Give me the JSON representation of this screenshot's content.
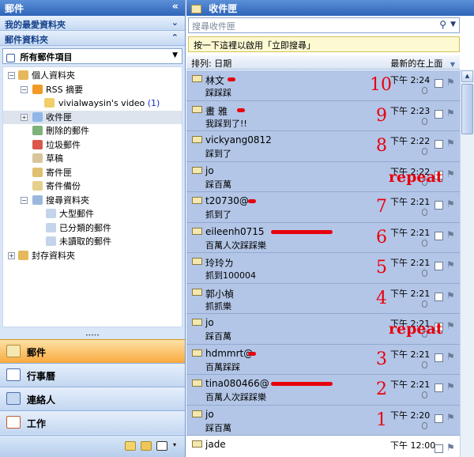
{
  "nav": {
    "title": "郵件",
    "collapse_glyph": "«",
    "favorites_header": "我的最愛資料夾",
    "mail_folders_header": "郵件資料夾",
    "filter_value": "所有郵件項目",
    "tree": [
      {
        "label": "個人資料夾",
        "icon": "personal-folders-icon"
      },
      {
        "label": "RSS 摘要",
        "icon": "rss-icon"
      },
      {
        "label": "vivialwaysin's video",
        "count": "(1)",
        "icon": "folder-icon"
      },
      {
        "label": "收件匣",
        "icon": "inbox-icon"
      },
      {
        "label": "刪除的郵件",
        "icon": "deleted-items-icon"
      },
      {
        "label": "垃圾郵件",
        "icon": "junk-icon"
      },
      {
        "label": "草稿",
        "icon": "drafts-icon"
      },
      {
        "label": "寄件匣",
        "icon": "outbox-icon"
      },
      {
        "label": "寄件備份",
        "icon": "sent-items-icon"
      },
      {
        "label": "搜尋資料夾",
        "icon": "search-folders-icon"
      },
      {
        "label": "大型郵件",
        "icon": "search-folder-icon"
      },
      {
        "label": "已分類的郵件",
        "icon": "search-folder-icon"
      },
      {
        "label": "未讀取的郵件",
        "icon": "search-folder-icon"
      },
      {
        "label": "封存資料夾",
        "icon": "archive-folder-icon"
      }
    ],
    "buttons": [
      {
        "label": "郵件",
        "icon": "mail-icon"
      },
      {
        "label": "行事曆",
        "icon": "calendar-icon"
      },
      {
        "label": "連絡人",
        "icon": "contacts-icon"
      },
      {
        "label": "工作",
        "icon": "tasks-icon"
      }
    ]
  },
  "main": {
    "title": "收件匣",
    "search_placeholder": "搜尋收件匣",
    "search_hint": "按一下這裡以啟用「立即搜尋」",
    "sort_label": "排列: 日期",
    "order_label": "最新的在上面"
  },
  "messages": [
    {
      "sender": "林文",
      "subject": "踩踩踩",
      "date": "下午 2:24",
      "note": "10",
      "redacted": true
    },
    {
      "sender": "畫 雅",
      "subject": "我踩到了!!",
      "date": "下午 2:23",
      "note": "9",
      "redacted": true
    },
    {
      "sender": "vickyang0812",
      "subject": "踩到了",
      "date": "下午 2:22",
      "note": "8"
    },
    {
      "sender": "jo",
      "subject": "踩百萬",
      "date": "下午 2:22",
      "note": "repeat"
    },
    {
      "sender": "t20730@",
      "subject": "抓到了",
      "date": "下午 2:21",
      "note": "7",
      "redacted": true
    },
    {
      "sender": "eileenh0715",
      "subject": "百萬人次踩踩樂",
      "date": "下午 2:21",
      "note": "6",
      "redacted": true
    },
    {
      "sender": "玲玲ㄌ",
      "subject": "抓到100004",
      "date": "下午 2:21",
      "note": "5"
    },
    {
      "sender": "郭小楨",
      "subject": "抓抓樂",
      "date": "下午 2:21",
      "note": "4"
    },
    {
      "sender": "jo",
      "subject": "踩百萬",
      "date": "下午 2:21",
      "note": "repeat"
    },
    {
      "sender": "hdmmrt@",
      "subject": "百萬踩踩",
      "date": "下午 2:21",
      "note": "3",
      "redacted": true
    },
    {
      "sender": "tina080466@",
      "subject": "百萬人次踩踩樂",
      "date": "下午 2:21",
      "note": "2",
      "redacted": true
    },
    {
      "sender": "jo",
      "subject": "踩百萬",
      "date": "下午 2:20",
      "note": "1"
    },
    {
      "sender": "jade",
      "subject": "",
      "date": "下午 12:00",
      "note": ""
    }
  ],
  "colors": {
    "selected_row": "#b3c6e7",
    "annotation": "#e8000d",
    "accent": "#2f65b9"
  }
}
